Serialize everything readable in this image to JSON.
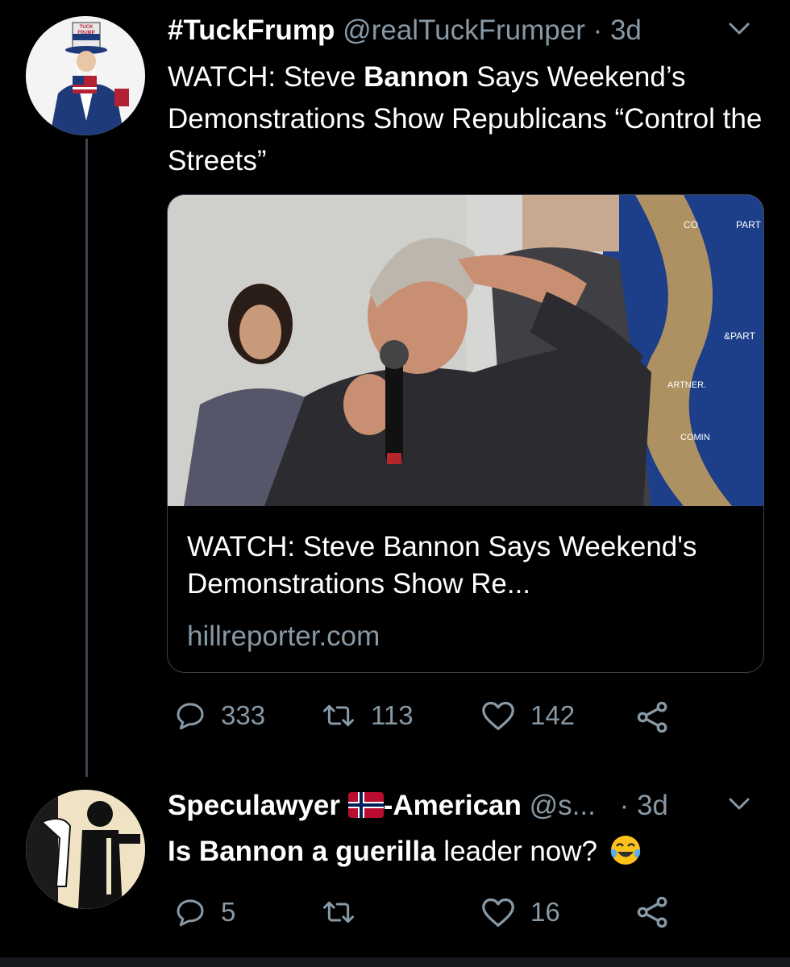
{
  "tweet": {
    "display_name": "#TuckFrump",
    "handle": "@realTuckFrumper",
    "time": " · 3d",
    "text_1": "WATCH: Steve ",
    "text_bold": "Bannon",
    "text_2": " Says Weekend’s Demonstrations Show Republicans “Control the Streets”",
    "avatar_text": "TUCK FRUMP",
    "card": {
      "title": "WATCH: Steve Bannon Says Weekend's Demonstrations Show Re...",
      "domain": "hillreporter.com",
      "backdrop_texts": [
        "CO",
        "PART",
        "&PART",
        "ARTNER.",
        "COMIN"
      ]
    },
    "stats": {
      "replies": "333",
      "retweets": "113",
      "likes": "142"
    }
  },
  "reply": {
    "display_name": "Speculawyer",
    "name_suffix": "-American",
    "handle": "@s...",
    "time": "· 3d",
    "text_bold": "Is Bannon a guerilla",
    "text_rest": " leader now?",
    "emoji": "😂",
    "stats": {
      "replies": "5",
      "retweets": "",
      "likes": "16"
    }
  },
  "colors": {
    "background": "#000000",
    "text": "#ffffff",
    "secondary": "#8899a6",
    "border": "#38444d",
    "flag_red": "#ba0c2f",
    "flag_blue": "#00205b"
  },
  "icons": [
    "chevron-down-icon",
    "reply-icon",
    "retweet-icon",
    "like-icon",
    "share-icon",
    "norway-flag-icon",
    "tears-of-joy-emoji"
  ]
}
